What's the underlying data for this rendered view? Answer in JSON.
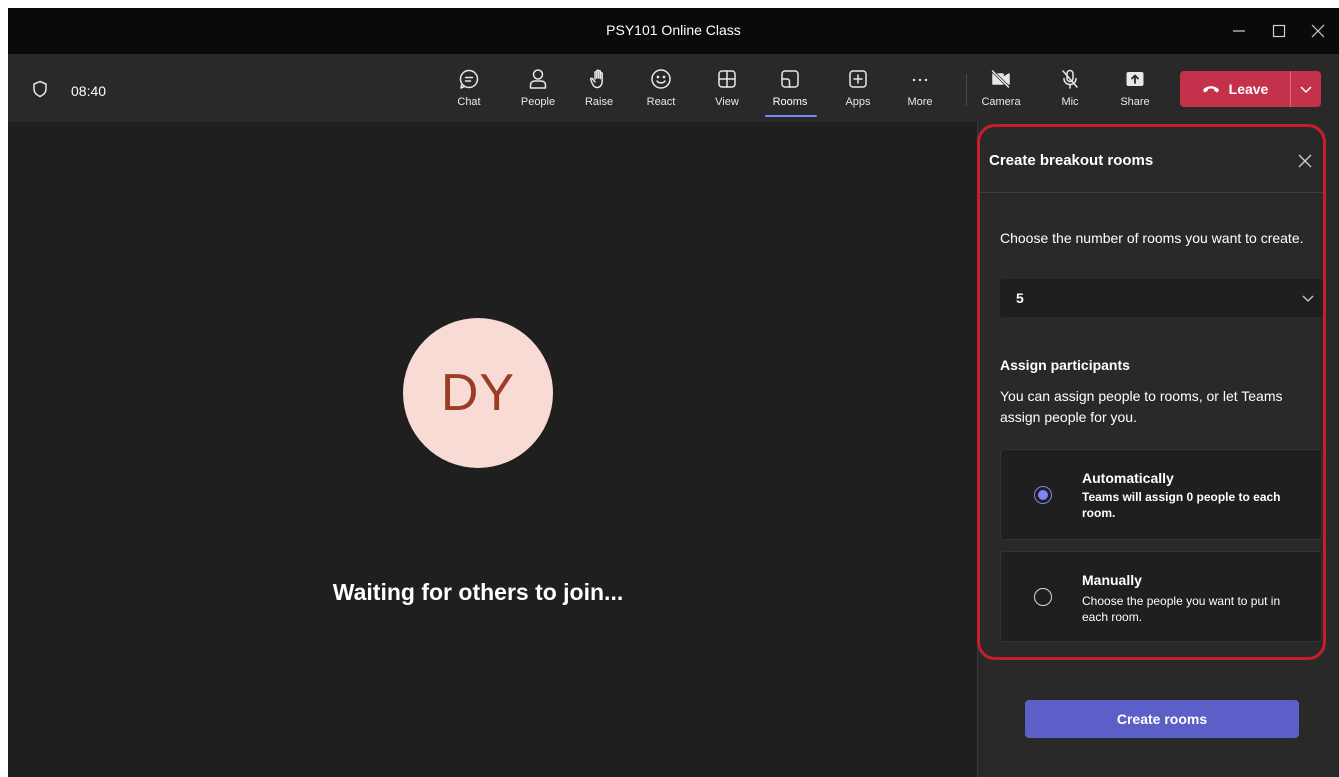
{
  "window": {
    "title": "PSY101 Online Class"
  },
  "toolbar": {
    "timer": "08:40",
    "buttons": [
      {
        "id": "chat",
        "label": "Chat",
        "icon": "chat-icon"
      },
      {
        "id": "people",
        "label": "People",
        "icon": "people-icon"
      },
      {
        "id": "raise",
        "label": "Raise",
        "icon": "raise-hand-icon"
      },
      {
        "id": "react",
        "label": "React",
        "icon": "smiley-icon"
      },
      {
        "id": "view",
        "label": "View",
        "icon": "grid-icon"
      },
      {
        "id": "rooms",
        "label": "Rooms",
        "icon": "rooms-icon",
        "active": true
      },
      {
        "id": "apps",
        "label": "Apps",
        "icon": "plus-box-icon"
      },
      {
        "id": "more",
        "label": "More",
        "icon": "more-icon"
      },
      {
        "id": "camera",
        "label": "Camera",
        "icon": "camera-off-icon"
      },
      {
        "id": "mic",
        "label": "Mic",
        "icon": "mic-off-icon"
      },
      {
        "id": "share",
        "label": "Share",
        "icon": "share-icon"
      }
    ],
    "leave_label": "Leave"
  },
  "stage": {
    "avatar_initials": "DY",
    "status": "Waiting for others to join..."
  },
  "panel": {
    "title": "Create breakout rooms",
    "rooms_prompt": "Choose the number of rooms you want to create.",
    "rooms_count": "5",
    "assign_heading": "Assign participants",
    "assign_desc": "You can assign people to rooms, or let Teams assign people for you.",
    "options": [
      {
        "title": "Automatically",
        "desc": "Teams will assign 0 people to each room.",
        "selected": true
      },
      {
        "title": "Manually",
        "desc": "Choose the people you want to put in each room.",
        "selected": false
      }
    ],
    "create_label": "Create rooms"
  },
  "colors": {
    "accent": "#7f85f5",
    "primary_button": "#5b5fc7",
    "leave": "#c4314b",
    "highlight": "#c81e2c",
    "avatar_bg": "#f9dbd6",
    "avatar_text": "#9b3d23"
  }
}
